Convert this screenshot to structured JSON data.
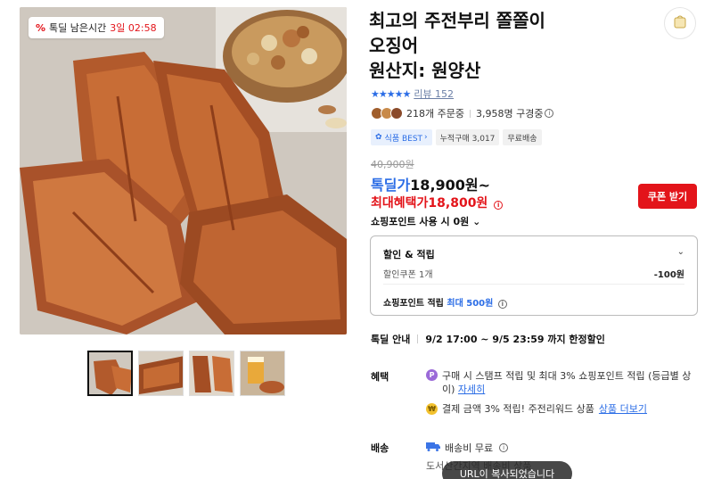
{
  "timer": {
    "label": "톡딜 남은시간",
    "time": "3일 02:58"
  },
  "product": {
    "title_line1": "최고의 주전부리 쫄쫄이",
    "title_line2": "오징어",
    "title_line3": "원산지: 원양산"
  },
  "rating": {
    "stars": 5,
    "review_label": "리뷰 152"
  },
  "buyers": {
    "orders": "218개 주문중",
    "wishlist": "3,958명 구경중"
  },
  "tags": [
    {
      "label": "식품 BEST",
      "icon": "gear-icon"
    },
    {
      "label": "누적구매 3,017"
    },
    {
      "label": "무료배송"
    }
  ],
  "price": {
    "original": "40,900원",
    "deal_label": "톡딜가",
    "deal_value": "18,900원~",
    "max_label": "최대혜택가",
    "max_value": "18,800원"
  },
  "coupon_button": "쿠폰 받기",
  "point_use": "쇼핑포인트 사용 시 0원",
  "discount_box": {
    "title": "할인 & 적립",
    "coupon_label": "할인쿠폰 1개",
    "coupon_amount": "-100원",
    "point_label": "쇼핑포인트 적립",
    "point_value": "최대 500원"
  },
  "deal_info": {
    "label": "톡딜 안내",
    "period": "9/2 17:00 ~ 9/5 23:59 까지 한정할인"
  },
  "benefit": {
    "label": "혜택",
    "item1": "구매 시 스탬프 적립 및 최대 3% 쇼핑포인트 적립 (등급별 상이)",
    "item1_link": "자세히",
    "item2": "결제 금액 3% 적립! 주전리워드 상품",
    "item2_link": "상품 더보기"
  },
  "shipping": {
    "label": "배송",
    "fee": "배송비 무료",
    "extra": "도서산간지역 배송비 상품"
  },
  "toast": "URL이 복사되었습니다",
  "colors": {
    "accent_blue": "#2b6de6",
    "accent_red": "#e3141a"
  }
}
